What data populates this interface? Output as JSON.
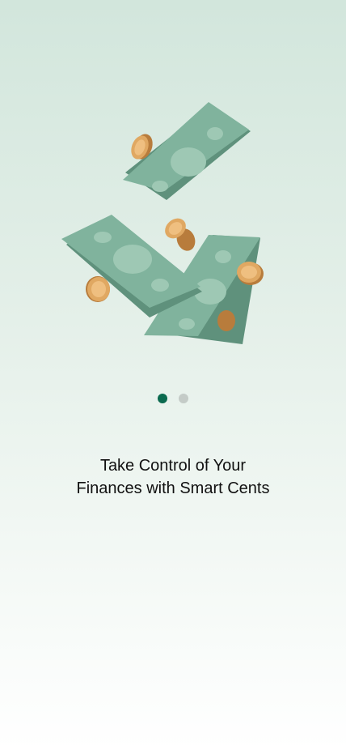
{
  "onboarding": {
    "illustration_icon": "flying-money-icon",
    "headline": "Take Control of Your Finances with Smart Cents",
    "pager": {
      "total": 2,
      "active_index": 0
    }
  },
  "colors": {
    "dot_active": "#0b6a4f",
    "dot_inactive": "#c4cbc7",
    "banknote": "#7fb39d",
    "coin": "#e0a862",
    "text": "#111111"
  }
}
